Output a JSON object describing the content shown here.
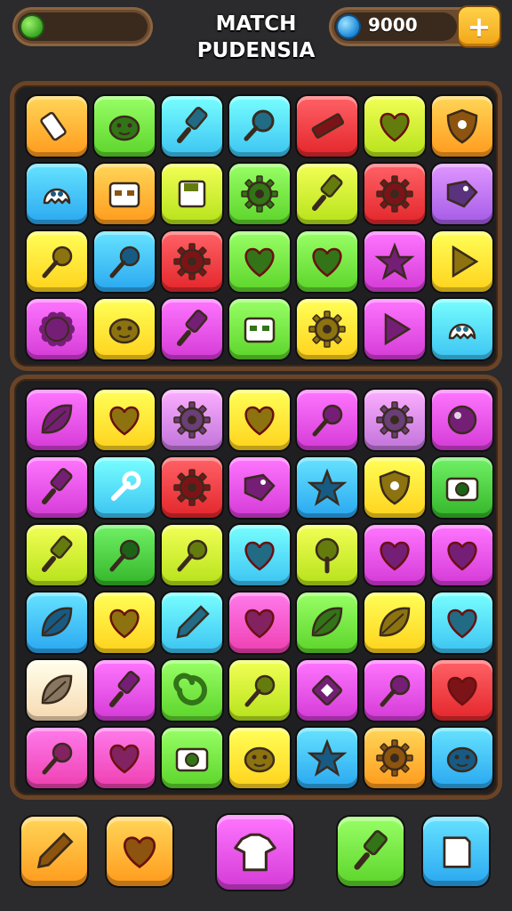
{
  "header": {
    "title_line1": "MATCH",
    "title_line2": "PUDENSIA",
    "coins": "9000",
    "plus_label": "+"
  },
  "palette": {
    "orange": "#ff9a1c",
    "green": "#5cd42a",
    "blue": "#2aa7f0",
    "cyan": "#3cc3f2",
    "red": "#e3262b",
    "lime": "#b6e21a",
    "purple": "#a45be6",
    "magenta": "#d43ad6",
    "yellow": "#ffd21c",
    "pink": "#ee3fb0",
    "lilac": "#c073d9",
    "peach": "#f7d9b0",
    "darkgreen": "#34b52a"
  },
  "board_top": [
    [
      {
        "color": "orange",
        "icon": "eraser-icon"
      },
      {
        "color": "green",
        "icon": "blob-face-icon"
      },
      {
        "color": "cyan",
        "icon": "brush-icon"
      },
      {
        "color": "cyan",
        "icon": "magnifier-icon"
      },
      {
        "color": "red",
        "icon": "ruler-icon"
      },
      {
        "color": "lime",
        "icon": "heart-icon"
      },
      {
        "color": "orange",
        "icon": "shield-icon"
      }
    ],
    [
      {
        "color": "blue",
        "icon": "ghost-icon"
      },
      {
        "color": "orange",
        "icon": "robot-box-icon"
      },
      {
        "color": "lime",
        "icon": "floppy-icon"
      },
      {
        "color": "green",
        "icon": "gear-icon"
      },
      {
        "color": "lime",
        "icon": "brush-icon"
      },
      {
        "color": "red",
        "icon": "gear-icon"
      },
      {
        "color": "purple",
        "icon": "tag-icon"
      }
    ],
    [
      {
        "color": "yellow",
        "icon": "pin-icon"
      },
      {
        "color": "blue",
        "icon": "pin-icon"
      },
      {
        "color": "red",
        "icon": "gear-icon"
      },
      {
        "color": "green",
        "icon": "heart-icon"
      },
      {
        "color": "green",
        "icon": "heart-icon"
      },
      {
        "color": "magenta",
        "icon": "star-icon"
      },
      {
        "color": "yellow",
        "icon": "play-icon"
      }
    ],
    [
      {
        "color": "magenta",
        "icon": "badge-icon"
      },
      {
        "color": "yellow",
        "icon": "blob-face-icon"
      },
      {
        "color": "magenta",
        "icon": "brush-icon"
      },
      {
        "color": "green",
        "icon": "robot-box-icon"
      },
      {
        "color": "yellow",
        "icon": "gear-icon"
      },
      {
        "color": "magenta",
        "icon": "play-icon"
      },
      {
        "color": "cyan",
        "icon": "ghost-icon"
      }
    ]
  ],
  "board_bottom": [
    [
      {
        "color": "magenta",
        "icon": "leaf-icon"
      },
      {
        "color": "yellow",
        "icon": "heart-icon"
      },
      {
        "color": "lilac",
        "icon": "gear-icon"
      },
      {
        "color": "yellow",
        "icon": "heart-icon"
      },
      {
        "color": "magenta",
        "icon": "pin-icon"
      },
      {
        "color": "lilac",
        "icon": "gear-icon"
      },
      {
        "color": "magenta",
        "icon": "orb-icon"
      }
    ],
    [
      {
        "color": "magenta",
        "icon": "brush-icon"
      },
      {
        "color": "cyan",
        "icon": "wrench-icon"
      },
      {
        "color": "red",
        "icon": "gear-icon"
      },
      {
        "color": "magenta",
        "icon": "tag-icon"
      },
      {
        "color": "blue",
        "icon": "star-icon"
      },
      {
        "color": "yellow",
        "icon": "shield-icon"
      },
      {
        "color": "darkgreen",
        "icon": "camera-icon"
      }
    ],
    [
      {
        "color": "lime",
        "icon": "brush-icon"
      },
      {
        "color": "darkgreen",
        "icon": "pin-icon"
      },
      {
        "color": "lime",
        "icon": "pin-icon"
      },
      {
        "color": "cyan",
        "icon": "heart-icon"
      },
      {
        "color": "lime",
        "icon": "tree-icon"
      },
      {
        "color": "magenta",
        "icon": "heart-icon"
      },
      {
        "color": "magenta",
        "icon": "heart-icon"
      }
    ],
    [
      {
        "color": "blue",
        "icon": "leaf-icon"
      },
      {
        "color": "yellow",
        "icon": "heart-icon"
      },
      {
        "color": "cyan",
        "icon": "pencil-icon"
      },
      {
        "color": "pink",
        "icon": "heart-icon"
      },
      {
        "color": "green",
        "icon": "leaf-icon"
      },
      {
        "color": "yellow",
        "icon": "leaf-icon"
      },
      {
        "color": "cyan",
        "icon": "heart-icon"
      }
    ],
    [
      {
        "color": "peach",
        "icon": "leaf-icon"
      },
      {
        "color": "magenta",
        "icon": "brush-icon"
      },
      {
        "color": "green",
        "icon": "swirl-icon"
      },
      {
        "color": "lime",
        "icon": "pin-icon"
      },
      {
        "color": "magenta",
        "icon": "square-icon"
      },
      {
        "color": "magenta",
        "icon": "pin-icon"
      },
      {
        "color": "red",
        "icon": "heart-icon"
      }
    ],
    [
      {
        "color": "pink",
        "icon": "pin-icon"
      },
      {
        "color": "pink",
        "icon": "heart-icon"
      },
      {
        "color": "green",
        "icon": "camera-icon"
      },
      {
        "color": "yellow",
        "icon": "blob-face-icon"
      },
      {
        "color": "blue",
        "icon": "star-icon"
      },
      {
        "color": "orange",
        "icon": "gear-icon"
      },
      {
        "color": "blue",
        "icon": "blob-face-icon"
      }
    ]
  ],
  "tools": [
    {
      "color": "orange",
      "icon": "pencil-icon"
    },
    {
      "color": "orange",
      "icon": "heart-icon"
    },
    {
      "color": "magenta",
      "icon": "shirt-icon"
    },
    {
      "color": "green",
      "icon": "brush-icon"
    },
    {
      "color": "blue",
      "icon": "paper-icon"
    }
  ]
}
